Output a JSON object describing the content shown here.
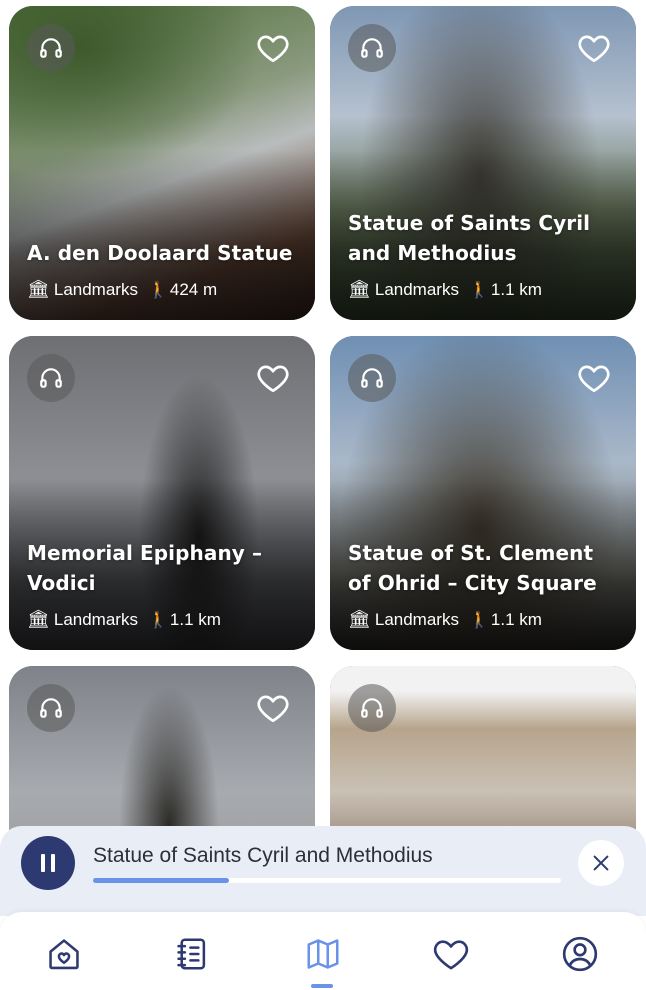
{
  "places": [
    {
      "title": "A. den Doolaard Statue",
      "category": "Landmarks",
      "distance": "424 m"
    },
    {
      "title": "Statue of Saints Cyril and Methodius",
      "category": "Landmarks",
      "distance": "1.1 km"
    },
    {
      "title": "Memorial Epiphany – Vodici",
      "category": "Landmarks",
      "distance": "1.1 km"
    },
    {
      "title": "Statue of St. Clement of Ohrid – City Square",
      "category": "Landmarks",
      "distance": "1.1 km"
    },
    {
      "title": "",
      "category": "",
      "distance": ""
    },
    {
      "title": "",
      "category": "",
      "distance": ""
    }
  ],
  "icons": {
    "audio": "headphones-icon",
    "favorite": "heart-outline-icon",
    "category": "museum-icon",
    "walk": "walking-person-icon"
  },
  "player": {
    "title": "Statue of Saints Cyril and Methodius",
    "progress": 0.29,
    "state": "playing"
  },
  "nav": {
    "items": [
      "home",
      "guide",
      "map",
      "favorites",
      "profile"
    ],
    "active": "map"
  },
  "colors": {
    "accent": "#6a93e8",
    "player_button": "#2d3a72",
    "player_bg": "#e9edf6",
    "nav_icon": "#2d3a72"
  }
}
